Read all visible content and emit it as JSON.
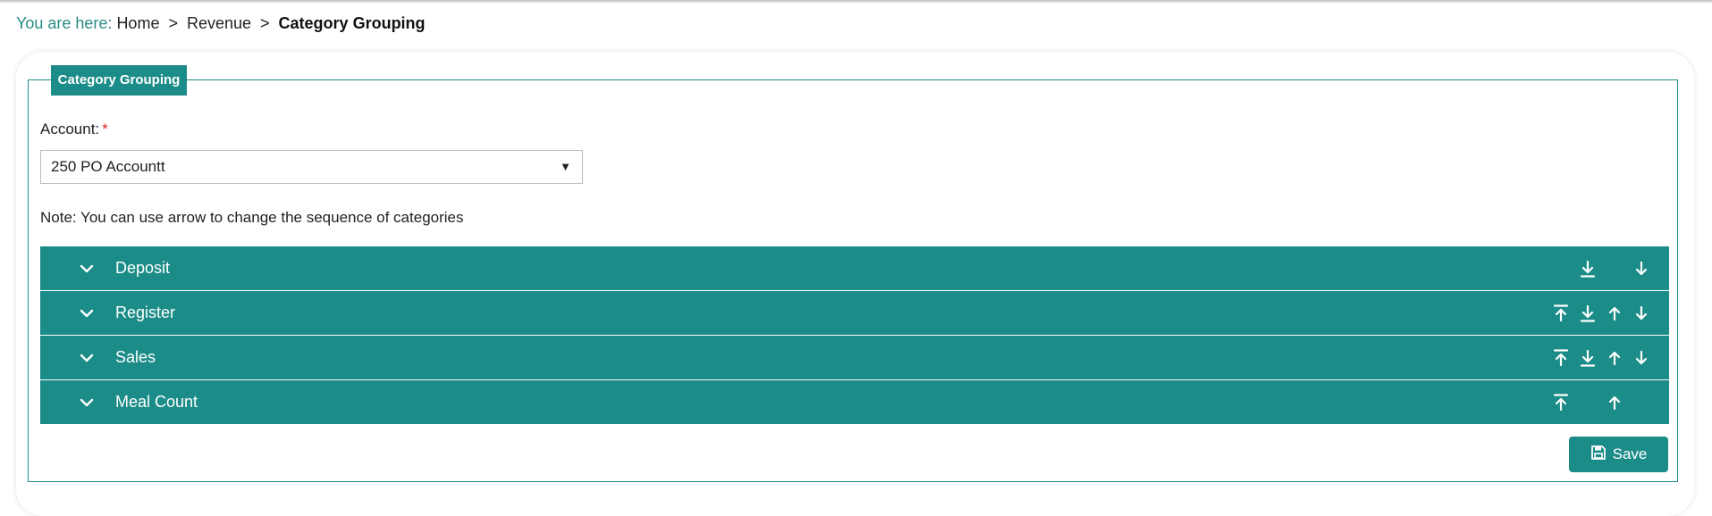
{
  "breadcrumb": {
    "prefix": "You are here:",
    "items": [
      "Home",
      "Revenue"
    ],
    "current": "Category Grouping",
    "separator": ">"
  },
  "panel": {
    "legend": "Category Grouping"
  },
  "account": {
    "label": "Account:",
    "required_mark": "*",
    "selected": "250 PO Accountt"
  },
  "note": "Note: You can use arrow to change the sequence of categories",
  "categories": [
    {
      "label": "Deposit"
    },
    {
      "label": "Register"
    },
    {
      "label": "Sales"
    },
    {
      "label": "Meal Count"
    }
  ],
  "save_label": "Save",
  "colors": {
    "accent": "#1c8c88",
    "breadcrumb_prefix": "#2a8c86",
    "required": "#dd2222"
  }
}
